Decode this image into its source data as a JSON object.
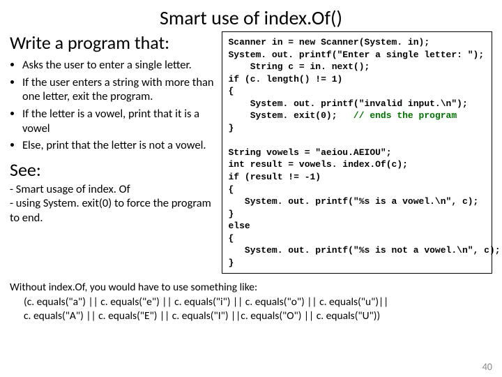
{
  "title": "Smart use of index.Of()",
  "left": {
    "subtitle": "Write a program that:",
    "bullets": [
      "Asks the user to enter a single letter.",
      "If the user enters a string with more than one letter, exit the program.",
      "If the letter is a vowel, print that it is a vowel",
      "Else, print that the letter is not a vowel."
    ],
    "see_heading": "See:",
    "see_lines": [
      "- Smart usage of index. Of",
      "- using System. exit(0) to force the program to end."
    ]
  },
  "code": {
    "l1": "Scanner in = new Scanner(System. in);",
    "l2": "System. out. printf(\"Enter a single letter: \");",
    "l3": "    String c = in. next();",
    "l4": "if (c. length() != 1)",
    "l5": "{",
    "l6": "    System. out. printf(\"invalid input.\\n\");",
    "l7a": "    System. exit(0);   ",
    "l7b": "// ends the program",
    "l8": "}",
    "l9": "",
    "l10": "String vowels = \"aeiou.AEIOU\";",
    "l11": "int result = vowels. index.Of(c);",
    "l12": "if (result != -1)",
    "l13": "{",
    "l14": "   System. out. printf(\"%s is a vowel.\\n\", c);",
    "l15": "}",
    "l16": "else",
    "l17": "{",
    "l18": "   System. out. printf(\"%s is not a vowel.\\n\", c);",
    "l19": "}"
  },
  "bottom": {
    "intro": "Without index.Of, you would have to use something like:",
    "line1": "(c. equals(\"a\") || c. equals(\"e\") || c. equals(\"i\") || c. equals(\"o\") || c. equals(\"u\")||",
    "line2": "c. equals(\"A\") || c. equals(\"E\") || c. equals(\"I\") ||c. equals(\"O\") || c. equals(\"U\"))"
  },
  "page_number": "40"
}
